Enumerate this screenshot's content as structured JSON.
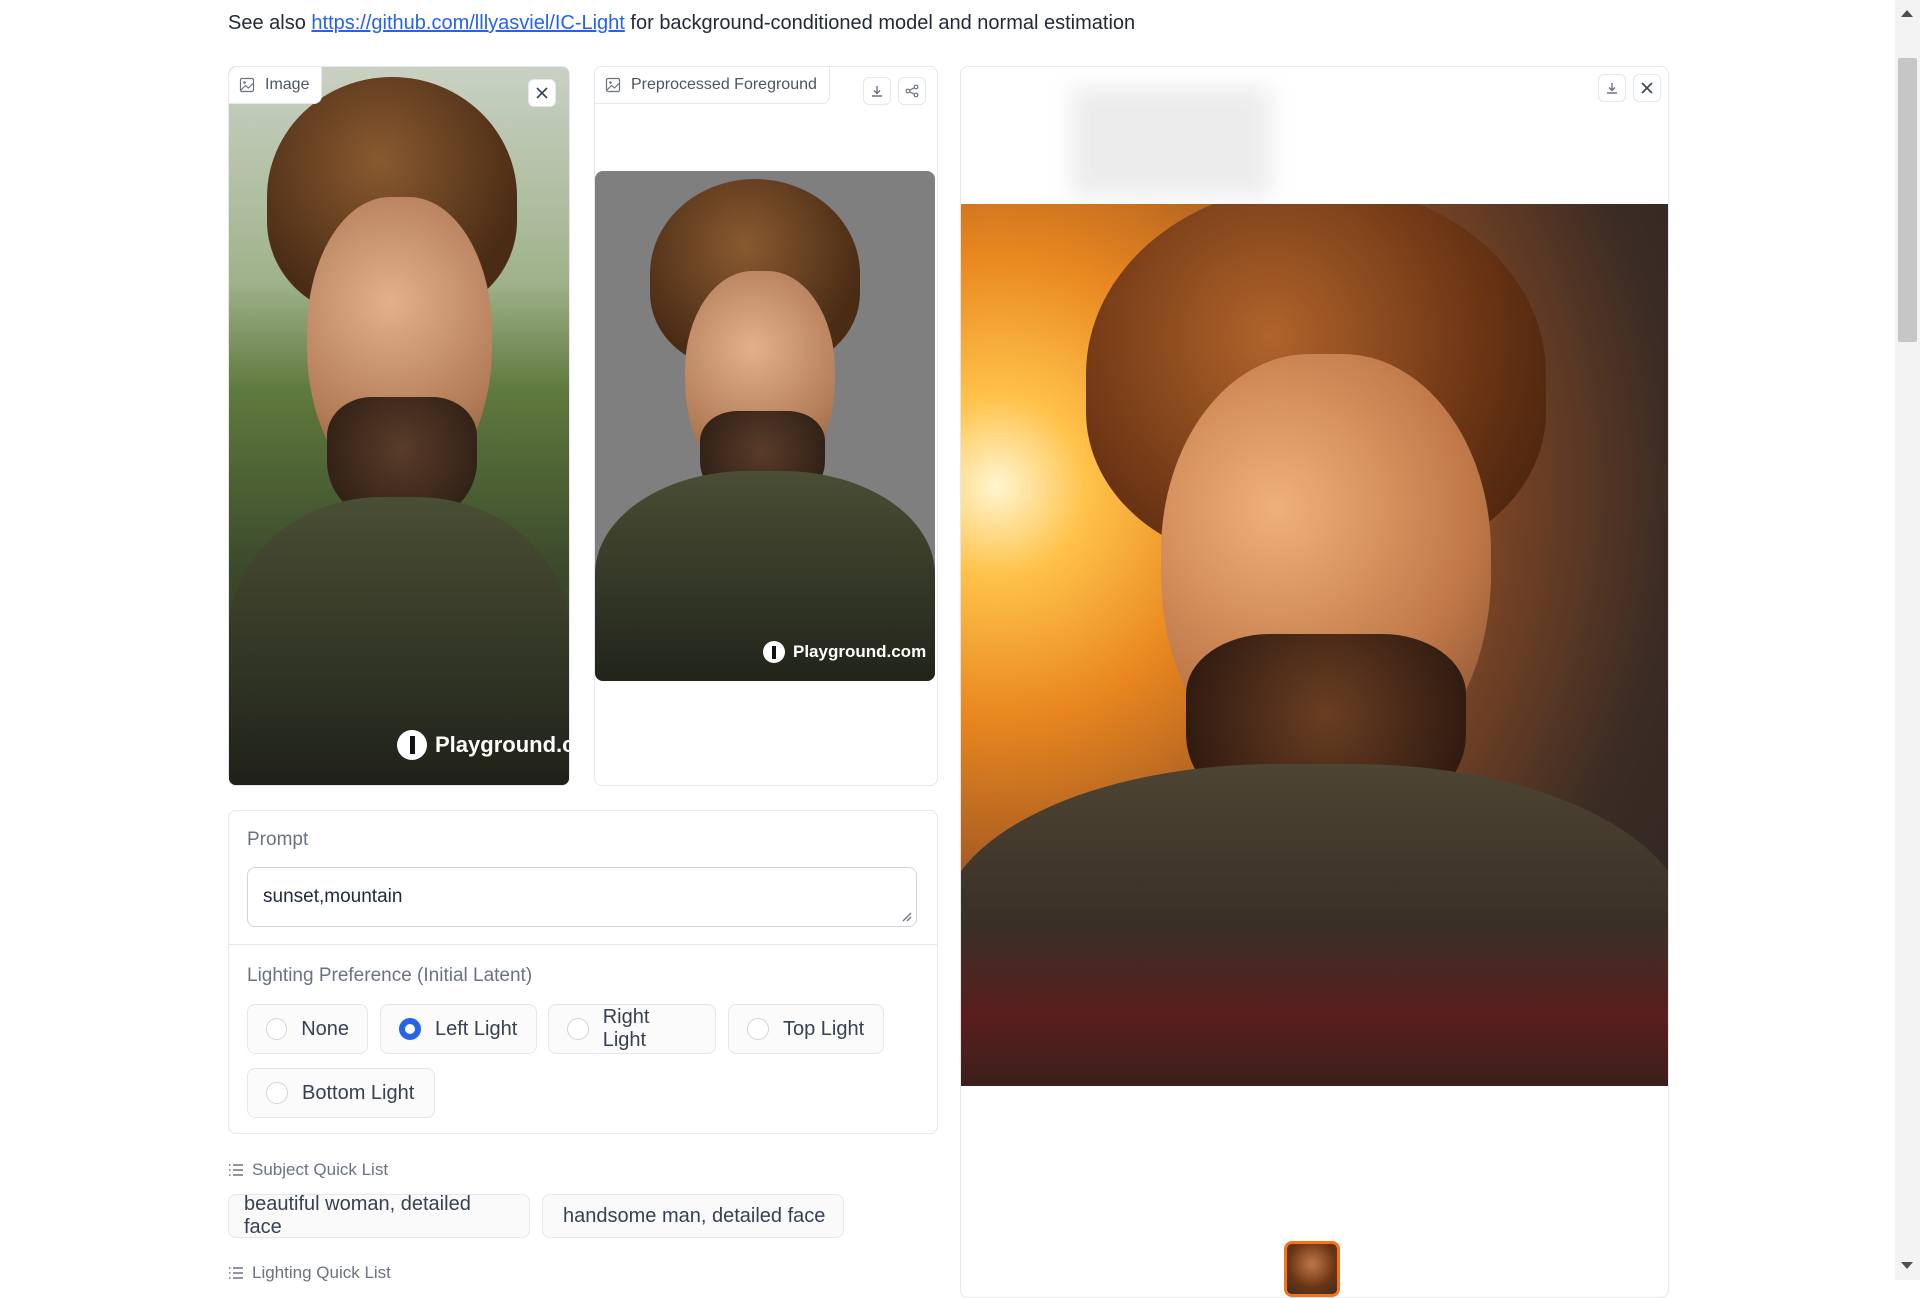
{
  "intro": {
    "prefix": "See also ",
    "link_text": "https://github.com/lllyasviel/IC-Light",
    "suffix": " for background-conditioned model and normal estimation"
  },
  "image_panel": {
    "label": "Image",
    "watermark": "Playground.c"
  },
  "preprocessed_panel": {
    "label": "Preprocessed Foreground",
    "watermark": "Playground.com"
  },
  "prompt": {
    "label": "Prompt",
    "value": "sunset,mountain"
  },
  "lighting": {
    "label": "Lighting Preference (Initial Latent)",
    "options": [
      "None",
      "Left Light",
      "Right Light",
      "Top Light",
      "Bottom Light"
    ],
    "selected": "Left Light"
  },
  "subject_quick_list": {
    "label": "Subject Quick List",
    "items": [
      "beautiful woman, detailed face",
      "handsome man, detailed face"
    ]
  },
  "lighting_quick_list": {
    "label": "Lighting Quick List"
  },
  "icons": [
    "image-icon",
    "close-icon",
    "download-icon",
    "share-icon",
    "list-icon"
  ],
  "colors": {
    "accent": "#2563eb",
    "link": "#2563eb"
  }
}
